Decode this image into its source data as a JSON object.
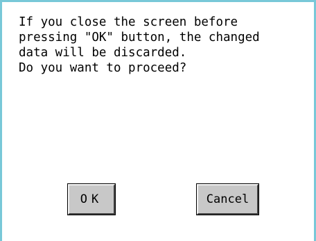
{
  "dialog": {
    "message_lines": [
      "If you close the screen before",
      "pressing \"OK\" button, the changed",
      "data will be discarded.",
      "Do you want to proceed?"
    ],
    "ok_label": "OK",
    "cancel_label": "Cancel"
  },
  "colors": {
    "border": "#78c8d8",
    "background": "#ffffff",
    "button_face": "#c8c8c8"
  }
}
